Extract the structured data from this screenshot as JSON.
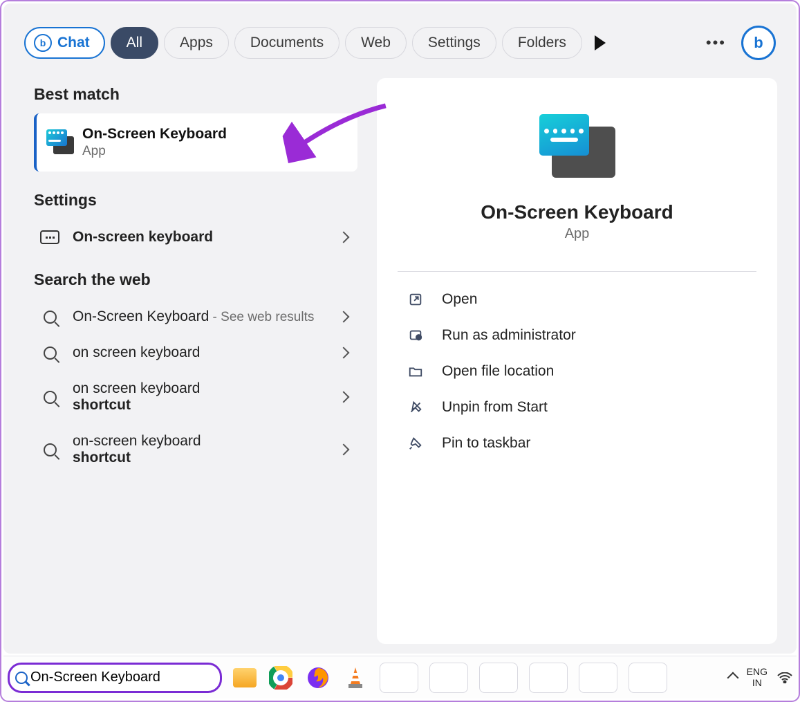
{
  "tabs": {
    "chat": "Chat",
    "items": [
      "All",
      "Apps",
      "Documents",
      "Web",
      "Settings",
      "Folders"
    ],
    "active_index": 0
  },
  "left": {
    "best_match_heading": "Best match",
    "best_match": {
      "title": "On-Screen Keyboard",
      "subtitle": "App"
    },
    "settings_heading": "Settings",
    "settings_item": "On-screen keyboard",
    "web_heading": "Search the web",
    "web_items": [
      {
        "main": "On-Screen Keyboard",
        "suffix": " - See web results",
        "sub": ""
      },
      {
        "main": "on screen keyboard",
        "suffix": "",
        "sub": ""
      },
      {
        "main": "on screen keyboard",
        "suffix": "",
        "sub": "shortcut"
      },
      {
        "main": "on-screen keyboard",
        "suffix": "",
        "sub": "shortcut"
      }
    ]
  },
  "detail": {
    "title": "On-Screen Keyboard",
    "subtitle": "App",
    "actions": [
      "Open",
      "Run as administrator",
      "Open file location",
      "Unpin from Start",
      "Pin to taskbar"
    ]
  },
  "taskbar": {
    "search_value": "On-Screen Keyboard",
    "lang_top": "ENG",
    "lang_bottom": "IN"
  }
}
